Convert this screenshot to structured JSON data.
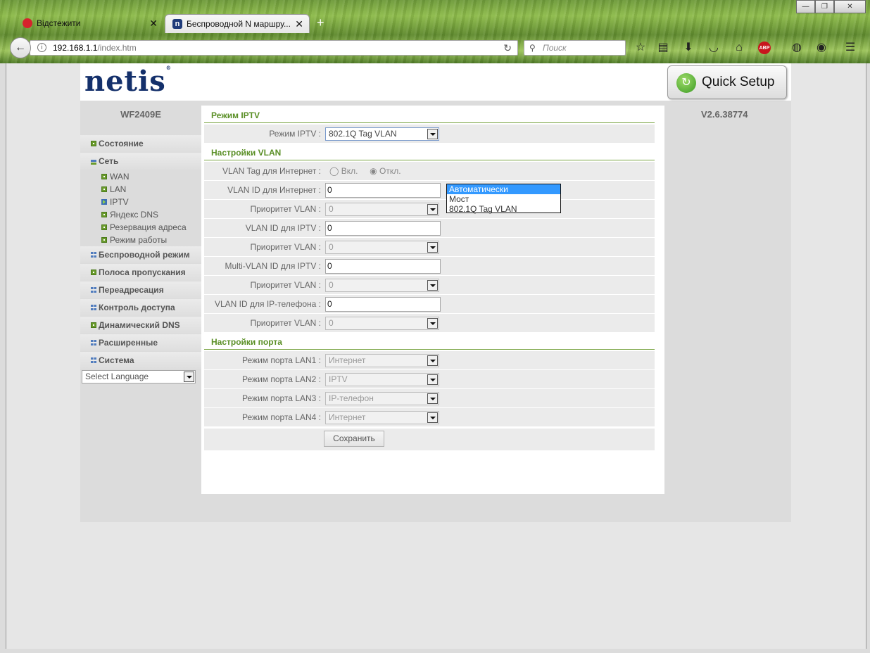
{
  "browser": {
    "tabs": [
      {
        "label": "Відстежити",
        "active": false
      },
      {
        "label": "Беспроводной N маршру...",
        "active": true
      }
    ],
    "url_host": "192.168.1.1",
    "url_path": "/index.htm",
    "search_placeholder": "Поиск",
    "abp_label": "ABP"
  },
  "router": {
    "logo": "netis",
    "quick_setup": "Quick Setup",
    "model": "WF2409E",
    "version": "V2.6.38774",
    "nav_main": [
      {
        "label": "Состояние",
        "icon": "plus"
      },
      {
        "label": "Сеть",
        "icon": "open"
      }
    ],
    "nav_sub": [
      {
        "label": "WAN",
        "icon": "plus"
      },
      {
        "label": "LAN",
        "icon": "plus"
      },
      {
        "label": "IPTV",
        "icon": "arrow"
      },
      {
        "label": "Яндекс DNS",
        "icon": "plus"
      },
      {
        "label": "Резервация адреса",
        "icon": "plus"
      },
      {
        "label": "Режим работы",
        "icon": "plus"
      }
    ],
    "nav_rest": [
      {
        "label": "Беспроводной режим",
        "icon": "grid"
      },
      {
        "label": "Полоса пропускания",
        "icon": "plus"
      },
      {
        "label": "Переадресация",
        "icon": "grid"
      },
      {
        "label": "Контроль доступа",
        "icon": "grid"
      },
      {
        "label": "Динамический DNS",
        "icon": "plus"
      },
      {
        "label": "Расширенные",
        "icon": "grid"
      },
      {
        "label": "Система",
        "icon": "grid"
      }
    ],
    "language_select": "Select Language"
  },
  "iptv": {
    "section_title": "Режим IPTV",
    "mode_label": "Режим IPTV :",
    "mode_value": "802.1Q Tag VLAN",
    "mode_options": [
      "Автоматически",
      "Мост",
      "802.1Q Tag VLAN"
    ],
    "mode_highlighted": "Автоматически"
  },
  "vlan": {
    "section_title": "Настройки VLAN",
    "tag_label": "VLAN Tag для Интернет :",
    "radio_on": "Вкл.",
    "radio_off": "Откл.",
    "rows": [
      {
        "label": "VLAN ID для Интернет :",
        "kind": "input",
        "value": "0"
      },
      {
        "label": "Приоритет VLAN :",
        "kind": "select",
        "value": "0"
      },
      {
        "label": "VLAN ID для IPTV :",
        "kind": "input",
        "value": "0"
      },
      {
        "label": "Приоритет VLAN :",
        "kind": "select",
        "value": "0"
      },
      {
        "label": "Multi-VLAN ID для IPTV :",
        "kind": "input",
        "value": "0"
      },
      {
        "label": "Приоритет VLAN :",
        "kind": "select",
        "value": "0"
      },
      {
        "label": "VLAN ID для IP-телефона :",
        "kind": "input",
        "value": "0"
      },
      {
        "label": "Приоритет VLAN :",
        "kind": "select",
        "value": "0"
      }
    ]
  },
  "ports": {
    "section_title": "Настройки порта",
    "rows": [
      {
        "label": "Режим порта LAN1 :",
        "value": "Интернет"
      },
      {
        "label": "Режим порта LAN2 :",
        "value": "IPTV"
      },
      {
        "label": "Режим порта LAN3 :",
        "value": "IP-телефон"
      },
      {
        "label": "Режим порта LAN4 :",
        "value": "Интернет"
      }
    ]
  },
  "save_label": "Сохранить"
}
